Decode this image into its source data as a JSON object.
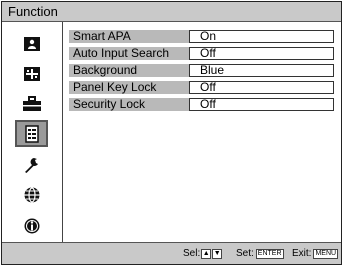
{
  "title": "Function",
  "sidebar": {
    "items": [
      {
        "icon": "picture-icon"
      },
      {
        "icon": "screen-adjust-icon"
      },
      {
        "icon": "setup-toolbox-icon"
      },
      {
        "icon": "function-list-icon",
        "selected": true
      },
      {
        "icon": "wrench-icon"
      },
      {
        "icon": "globe-icon"
      },
      {
        "icon": "info-icon"
      }
    ]
  },
  "menu": {
    "rows": [
      {
        "label": "Smart APA",
        "value": "On"
      },
      {
        "label": "Auto Input Search",
        "value": "Off"
      },
      {
        "label": "Background",
        "value": "Blue"
      },
      {
        "label": "Panel Key Lock",
        "value": "Off"
      },
      {
        "label": "Security Lock",
        "value": "Off"
      }
    ]
  },
  "footer": {
    "sel_label": "Sel:",
    "set_label": "Set:",
    "set_key": "ENTER",
    "exit_label": "Exit:",
    "exit_key": "MENU"
  }
}
